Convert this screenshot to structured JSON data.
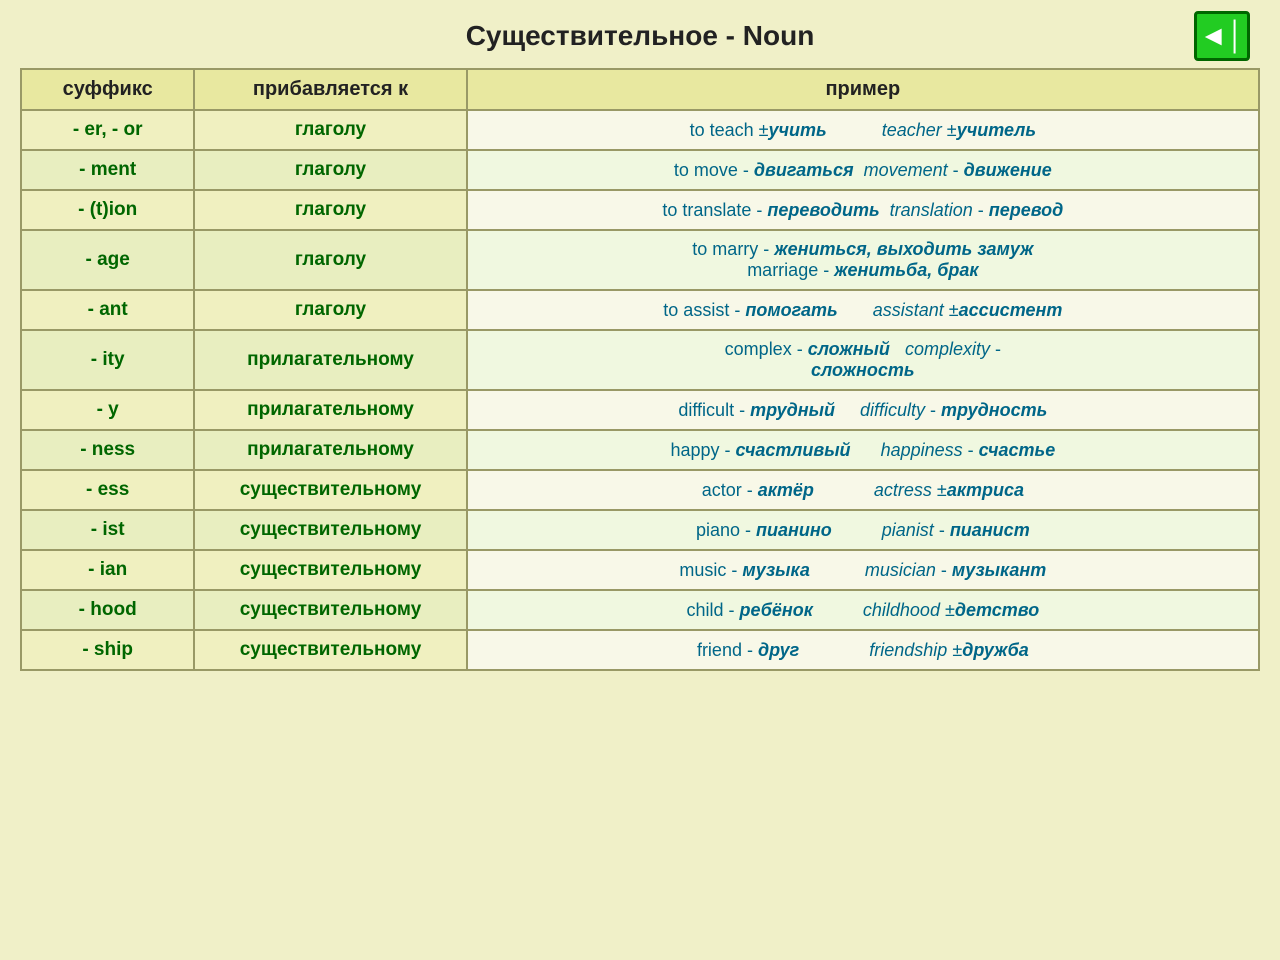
{
  "header": {
    "title": "Существительное - Noun",
    "nav_icon": "◀|"
  },
  "table": {
    "columns": [
      "суффикс",
      "прибавляется к",
      "пример"
    ],
    "rows": [
      {
        "suffix": "- er, - or",
        "added_to": "глаголу",
        "example_html": "to teach ±<i><b>учить</b></i>&nbsp;&nbsp;&nbsp;&nbsp;&nbsp;&nbsp;&nbsp;&nbsp;&nbsp;&nbsp;&nbsp;<i>teacher</i> ±<i><b>учитель</b></i>"
      },
      {
        "suffix": "- ment",
        "added_to": "глаголу",
        "example_html": "to move - <i><b>двигаться</b></i>&nbsp;&nbsp;<i>movement</i> - <i><b>движение</b></i>"
      },
      {
        "suffix": "- (t)ion",
        "added_to": "глаголу",
        "example_html": "to translate - <i><b>переводить</b></i>&nbsp;&nbsp;<i>translation</i> - <i><b>перевод</b></i>"
      },
      {
        "suffix": "- age",
        "added_to": "глаголу",
        "example_html": "to marry - <i><b>жениться, выходить замуж</b></i><br>marriage - <i><b>женитьба, брак</b></i>"
      },
      {
        "suffix": "- ant",
        "added_to": "глаголу",
        "example_html": "to assist - <i><b>помогать</b></i>&nbsp;&nbsp;&nbsp;&nbsp;&nbsp;&nbsp;&nbsp;<i>assistant</i> ±<i><b>ассистент</b></i>"
      },
      {
        "suffix": "- ity",
        "added_to": "прилагательному",
        "example_html": "complex - <i><b>сложный</b></i>&nbsp;&nbsp;&nbsp;<i>complexity</i> -<br><i><b>сложность</b></i>"
      },
      {
        "suffix": "- y",
        "added_to": "прилагательному",
        "example_html": "difficult - <i><b>трудный</b></i>&nbsp;&nbsp;&nbsp;&nbsp;&nbsp;<i>difficulty</i> - <i><b>трудность</b></i>"
      },
      {
        "suffix": "- ness",
        "added_to": "прилагательному",
        "example_html": "happy - <i><b>счастливый</b></i>&nbsp;&nbsp;&nbsp;&nbsp;&nbsp;&nbsp;<i>happiness</i> - <i><b>счастье</b></i>"
      },
      {
        "suffix": "- ess",
        "added_to": "существительному",
        "example_html": "actor - <i><b>актёр</b></i>&nbsp;&nbsp;&nbsp;&nbsp;&nbsp;&nbsp;&nbsp;&nbsp;&nbsp;&nbsp;&nbsp;&nbsp;<i>actress</i> ±<i><b>актриса</b></i>"
      },
      {
        "suffix": "- ist",
        "added_to": "существительному",
        "example_html": "piano - <i><b>пианино</b></i>&nbsp;&nbsp;&nbsp;&nbsp;&nbsp;&nbsp;&nbsp;&nbsp;&nbsp;&nbsp;<i>pianist</i> - <i><b>пианист</b></i>"
      },
      {
        "suffix": "- ian",
        "added_to": "существительному",
        "example_html": "music - <i><b>музыка</b></i>&nbsp;&nbsp;&nbsp;&nbsp;&nbsp;&nbsp;&nbsp;&nbsp;&nbsp;&nbsp;&nbsp;<i>musician</i> - <i><b>музыкант</b></i>"
      },
      {
        "suffix": "- hood",
        "added_to": "существительному",
        "example_html": "child - <i><b>ребёнок</b></i>&nbsp;&nbsp;&nbsp;&nbsp;&nbsp;&nbsp;&nbsp;&nbsp;&nbsp;&nbsp;<i>childhood</i> ±<i><b>детство</b></i>"
      },
      {
        "suffix": "- ship",
        "added_to": "существительному",
        "example_html": "friend - <i><b>друг</b></i>&nbsp;&nbsp;&nbsp;&nbsp;&nbsp;&nbsp;&nbsp;&nbsp;&nbsp;&nbsp;&nbsp;&nbsp;&nbsp;&nbsp;<i>friendship</i> ±<i><b>дружба</b></i>"
      }
    ]
  }
}
